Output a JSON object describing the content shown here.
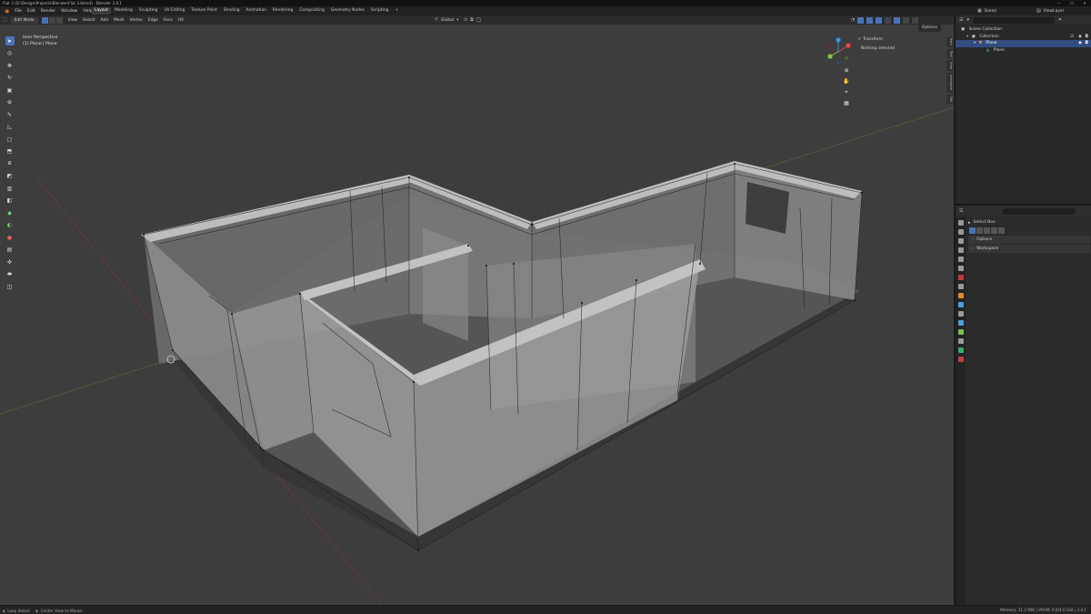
{
  "window": {
    "title": "Flat 3 [D:\\Design\\Projects\\Blender\\Flat 3.blend] - Blender 3.4.1",
    "controls": [
      "—",
      "☐",
      "✕"
    ]
  },
  "menu": [
    "File",
    "Edit",
    "Render",
    "Window",
    "Help"
  ],
  "workspaces": [
    "Layout",
    "Modeling",
    "Sculpting",
    "UV Editing",
    "Texture Paint",
    "Shading",
    "Animation",
    "Rendering",
    "Compositing",
    "Geometry Nodes",
    "Scripting",
    "+"
  ],
  "active_workspace": "Layout",
  "scene": {
    "label": "Scene",
    "view_layer": "ViewLayer"
  },
  "header3d": {
    "mode": "Edit Mode",
    "menus": [
      "View",
      "Select",
      "Add",
      "Mesh",
      "Vertex",
      "Edge",
      "Face",
      "UV"
    ],
    "transform_orientation": "Global",
    "options": "Options"
  },
  "viewport": {
    "view_name": "User Perspective",
    "object_info": "(1) Plane | Plane",
    "transform_panel_title": "Transform",
    "transform_panel_msg": "Nothing selected"
  },
  "tools": [
    {
      "name": "select-box-icon",
      "glyph": "➤",
      "active": true
    },
    {
      "name": "cursor-icon",
      "glyph": "◎"
    },
    {
      "name": "move-icon",
      "glyph": "✥"
    },
    {
      "name": "rotate-icon",
      "glyph": "↻"
    },
    {
      "name": "scale-icon",
      "glyph": "▣"
    },
    {
      "name": "transform-icon",
      "glyph": "⊕"
    },
    {
      "name": "annotate-icon",
      "glyph": "✎"
    },
    {
      "name": "measure-icon",
      "glyph": "◺"
    },
    {
      "name": "add-cube-icon",
      "glyph": "▢"
    },
    {
      "name": "extrude-icon",
      "glyph": "⬒"
    },
    {
      "name": "inset-icon",
      "glyph": "⧈"
    },
    {
      "name": "bevel-icon",
      "glyph": "◩"
    },
    {
      "name": "loop-cut-icon",
      "glyph": "▥"
    },
    {
      "name": "knife-icon",
      "glyph": "◧"
    },
    {
      "name": "poly-build-icon",
      "glyph": "◆"
    },
    {
      "name": "spin-icon",
      "glyph": "◐"
    },
    {
      "name": "smooth-icon",
      "glyph": "●"
    },
    {
      "name": "edge-slide-icon",
      "glyph": "▤"
    },
    {
      "name": "shrink-icon",
      "glyph": "✜"
    },
    {
      "name": "shear-icon",
      "glyph": "⬬"
    },
    {
      "name": "rip-icon",
      "glyph": "◫"
    }
  ],
  "nav_controls": [
    {
      "name": "zoom-icon",
      "glyph": "⊕"
    },
    {
      "name": "pan-hand-icon",
      "glyph": "✋"
    },
    {
      "name": "camera-view-icon",
      "glyph": "⌖"
    },
    {
      "name": "grid-view-icon",
      "glyph": "▦"
    }
  ],
  "gizmo": {
    "x_color": "#e8474f",
    "y_color": "#8bc43b",
    "z_color": "#3f8fe0"
  },
  "side_tabs": [
    "Item",
    "Tool",
    "View",
    "Animation",
    "Edit"
  ],
  "outliner": {
    "search_placeholder": "",
    "rows": [
      {
        "label": "Scene Collection",
        "indent": 0,
        "selected": false
      },
      {
        "label": "Collection",
        "indent": 1,
        "selected": false
      },
      {
        "label": "Plane",
        "indent": 2,
        "selected": true
      },
      {
        "label": "Plane",
        "indent": 3,
        "selected": false
      }
    ]
  },
  "properties": {
    "search_placeholder": "",
    "tool_name": "Select Box",
    "panels": [
      "Options",
      "Workspace"
    ],
    "icon_colors": [
      "#9a9a9a",
      "#9a9a9a",
      "#9a9a9a",
      "#9a9a9a",
      "#9a9a9a",
      "#9a9a9a",
      "#c03a3a",
      "#9a9a9a",
      "#e08a2a",
      "#4aa0e0",
      "#9a9a9a",
      "#4aa0e0",
      "#7ac04a",
      "#9a9a9a",
      "#30b070",
      "#c04040"
    ]
  },
  "statusbar": {
    "left": [
      "Loop Select",
      "Center View to Mouse"
    ],
    "right": "Memory: 31.2 MiB | VRAM: 0.6/4.0 GiB | 3.4.1"
  },
  "colors": {
    "accent": "#4a72b8",
    "viewport_bg": "#3d3d3d",
    "selected_row": "#334d80"
  }
}
